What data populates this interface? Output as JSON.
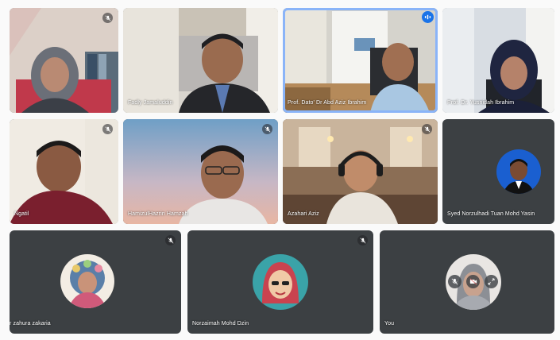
{
  "meeting": {
    "tiles": [
      {
        "name": "",
        "mic": "mic-off-icon"
      },
      {
        "name": "Fadly Jamaluddin",
        "mic": ""
      },
      {
        "name": "Prof. Dato' Dr Abd Aziz Ibrahim",
        "mic": "speaking-icon",
        "active": true
      },
      {
        "name": "Prof. Dr. Yusnidah Ibrahim",
        "mic": ""
      },
      {
        "name": "Ngatil",
        "mic": "mic-off-icon"
      },
      {
        "name": "HamizulHazrin Hamzah",
        "mic": "mic-off-icon"
      },
      {
        "name": "Azahari Aziz",
        "mic": "mic-off-icon"
      },
      {
        "name": "Syed Norzulhadi Tuan Mohd Yasin",
        "mic": ""
      },
      {
        "name": "r zahura zakaria",
        "mic": "mic-off-icon"
      },
      {
        "name": "Norzaimah Mohd Dzin",
        "mic": "mic-off-icon"
      },
      {
        "name": "You",
        "mic": ""
      }
    ],
    "self_controls": [
      "mic-off-icon",
      "camera-off-icon",
      "expand-icon"
    ],
    "colors": {
      "tile": "#3c4043",
      "active_border": "#8ab4f8",
      "speaking": "#1a73e8",
      "background": "#fafafa"
    }
  }
}
